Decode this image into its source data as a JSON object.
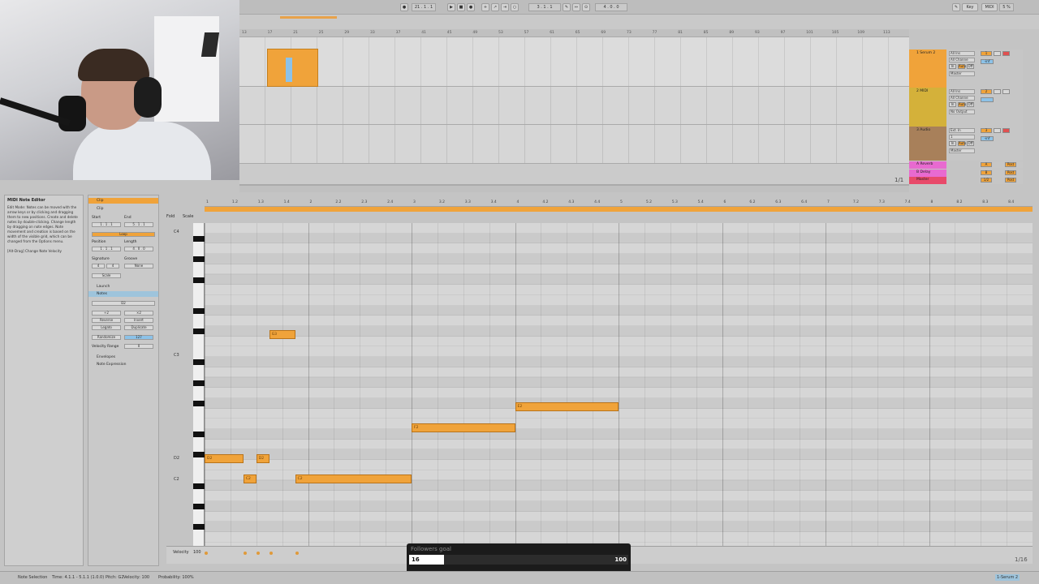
{
  "webcam": {
    "description": ""
  },
  "transport": {
    "tempo": "21 . 1 . 1",
    "position": "3 . 1 . 1",
    "end": "4 . 0 . 0",
    "key_label": "Key",
    "midi_label": "MIDI",
    "cpu": "5 %"
  },
  "arrangement": {
    "ruler": [
      "13",
      "17",
      "21",
      "25",
      "29",
      "33",
      "37",
      "41",
      "45",
      "49",
      "53",
      "57",
      "61",
      "65",
      "69",
      "73",
      "77",
      "81",
      "85",
      "89",
      "93",
      "97",
      "101",
      "105",
      "109",
      "113"
    ],
    "time_ruler": [
      "0:10",
      "0:20",
      "0:30",
      "0:40",
      "0:50",
      "1:00",
      "1:10",
      "1:20",
      "1:30",
      "1:40",
      "1:50",
      "2:00",
      "2:10",
      "2:20",
      "2:30",
      "2:40",
      "2:50",
      "3:00",
      "3:10"
    ],
    "fraction": "1/1"
  },
  "tracks": [
    {
      "name": "1 Serum 2",
      "color": "#f0a33a",
      "input": "All Ins",
      "channel": "All Channe",
      "monitor": [
        "In",
        "Auto",
        "Off"
      ],
      "output": "Master",
      "number": "1",
      "vol": "-inf"
    },
    {
      "name": "2 MIDI",
      "color": "#d4b13a",
      "input": "All Ins",
      "channel": "All Channe",
      "monitor": [
        "In",
        "Auto",
        "Off"
      ],
      "output": "No Output",
      "number": "2",
      "vol": ""
    },
    {
      "name": "3 Audio",
      "color": "#a8805a",
      "input": "Ext. In",
      "channel": "1",
      "monitor": [
        "In",
        "Auto",
        "Off"
      ],
      "output": "Master",
      "number": "3",
      "vol": "-inf"
    }
  ],
  "returns": [
    {
      "name": "A Reverb",
      "color": "#e86ad0",
      "letter": "A",
      "post": "Post"
    },
    {
      "name": "B Delay",
      "color": "#e86ad0",
      "letter": "B",
      "post": "Post"
    },
    {
      "name": "Master",
      "color": "#e84a6a",
      "letter": "1/2",
      "post": "Post"
    }
  ],
  "info_view": {
    "title": "MIDI Note Editor",
    "body": "Edit Mode: Notes can be moved with the arrow keys or by clicking and dragging them to new positions. Create and delete notes by double-clicking. Change length by dragging on note edges. Note movement and creation is based on the width of the visible grid, which can be changed from the Options menu.",
    "hint": "[Alt-Drag] Change Note Velocity"
  },
  "clip_panel": {
    "header": "Clip",
    "sub_header": "Clip",
    "start_label": "Start",
    "end_label": "End",
    "start_value": "1 . 1 . 1",
    "end_value": "5 . 1 . 1",
    "loop_label": "Loop",
    "position_label": "Position",
    "length_label": "Length",
    "position_value": "1 . 1 . 1",
    "length_value": "4 . 0 . 0",
    "signature_label": "Signature",
    "groove_label": "Groove",
    "sig_num": "4",
    "sig_den": "4",
    "groove_value": "None",
    "scale_label": "Scale",
    "launch_label": "Launch",
    "notes_label": "Notes",
    "note_name": "D2",
    "transpose_down": "÷2",
    "transpose_up": "×2",
    "reverse": "Reverse",
    "invert": "Invert",
    "legato": "Legato",
    "duplicate": "Duplicate",
    "randomize": "Randomize",
    "randomize_value": "127",
    "velocity_range_label": "Velocity Range",
    "velocity_range_value": "0",
    "envelopes_label": "Envelopes",
    "note_expression_label": "Note Expression"
  },
  "editor": {
    "fold_label": "Fold",
    "scale_label": "Scale",
    "ruler": [
      "1",
      "1.2",
      "1.3",
      "1.4",
      "2",
      "2.2",
      "2.3",
      "2.4",
      "3",
      "3.2",
      "3.3",
      "3.4",
      "4",
      "4.2",
      "4.3",
      "4.4",
      "5",
      "5.2",
      "5.3",
      "5.4",
      "6",
      "6.2",
      "6.3",
      "6.4",
      "7",
      "7.2",
      "7.3",
      "7.4",
      "8",
      "8.2",
      "8.3",
      "8.4"
    ],
    "pitch_labels": [
      {
        "label": "C4",
        "row": 0
      },
      {
        "label": "C3",
        "row": 12
      },
      {
        "label": "D2",
        "row": 22
      },
      {
        "label": "C2",
        "row": 24
      }
    ],
    "notes": [
      {
        "label": "G3",
        "pitch_row": 10.5,
        "start": 0.625,
        "len": 0.25
      },
      {
        "label": "E2",
        "pitch_row": 17.5,
        "start": 3.0,
        "len": 1.0
      },
      {
        "label": "F2",
        "pitch_row": 19.5,
        "start": 2.0,
        "len": 1.0
      },
      {
        "label": "D2",
        "pitch_row": 22.5,
        "start": 0.0,
        "len": 0.375
      },
      {
        "label": "D2",
        "pitch_row": 22.5,
        "start": 0.5,
        "len": 0.125
      },
      {
        "label": "C2",
        "pitch_row": 24.5,
        "start": 0.375,
        "len": 0.125
      },
      {
        "label": "C2",
        "pitch_row": 24.5,
        "start": 0.875,
        "len": 1.125
      }
    ],
    "velocity_label": "Velocity",
    "velocity_value": "100",
    "grid_resolution": "1/16"
  },
  "followers_goal": {
    "title": "Followers goal",
    "current": "16",
    "goal": "100",
    "progress": 0.16
  },
  "status_bar": {
    "selection": "Note Selection",
    "time": "Time: 4.1.1 - 5.1.1 (1.0.0)",
    "pitch": "Pitch: G2",
    "velocity": "Velocity: 100",
    "probability": "Probability: 100%",
    "track_name": "1-Serum 2"
  },
  "colors": {
    "clip": "#f0a33a",
    "selection": "#8cc2e8"
  }
}
